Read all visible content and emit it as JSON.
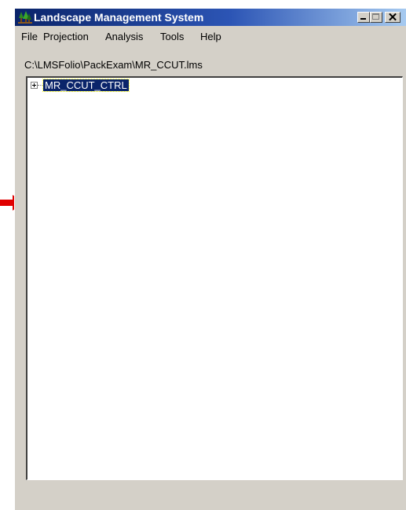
{
  "window": {
    "title": "Landscape Management System"
  },
  "menu": {
    "items": [
      "File",
      "Projection",
      "Analysis",
      "Tools",
      "Help"
    ]
  },
  "path_label": "C:\\LMSFolio\\PackExam\\MR_CCUT.lms",
  "tree": {
    "nodes": [
      {
        "label": "MR_CCUT_CTRL",
        "expanded": false,
        "selected": true
      }
    ]
  },
  "colors": {
    "titlebar_start": "#0a246a",
    "titlebar_end": "#a6caf0",
    "window_bg": "#d4d0c8",
    "selection": "#0a246a",
    "arrow": "#e00000"
  },
  "icons": {
    "app": "tree-logo-icon",
    "pointer": "red-arrow-icon"
  }
}
